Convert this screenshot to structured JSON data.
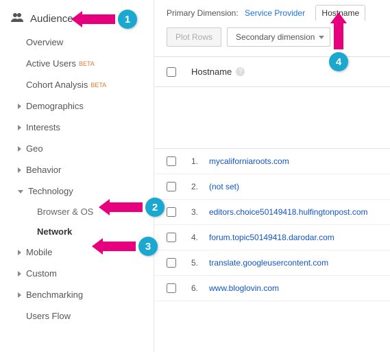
{
  "sidebar": {
    "section_label": "Audience",
    "items": [
      {
        "label": "Overview",
        "expandable": false
      },
      {
        "label": "Active Users",
        "expandable": false,
        "badge": "BETA"
      },
      {
        "label": "Cohort Analysis",
        "expandable": false,
        "badge": "BETA"
      },
      {
        "label": "Demographics",
        "expandable": true
      },
      {
        "label": "Interests",
        "expandable": true
      },
      {
        "label": "Geo",
        "expandable": true
      },
      {
        "label": "Behavior",
        "expandable": true
      },
      {
        "label": "Technology",
        "expandable": true,
        "expanded": true,
        "children": [
          {
            "label": "Browser & OS"
          },
          {
            "label": "Network",
            "selected": true
          }
        ]
      },
      {
        "label": "Mobile",
        "expandable": true
      },
      {
        "label": "Custom",
        "expandable": true
      },
      {
        "label": "Benchmarking",
        "expandable": true
      },
      {
        "label": "Users Flow",
        "expandable": false
      }
    ]
  },
  "primary_dimension": {
    "label": "Primary Dimension:",
    "link_service_provider": "Service Provider",
    "tab_hostname": "Hostname"
  },
  "controls": {
    "plot_rows": "Plot Rows",
    "secondary_dimension": "Secondary dimension"
  },
  "table": {
    "header_col": "Hostname",
    "rows": [
      {
        "idx": "1.",
        "host": "mycaliforniaroots.com"
      },
      {
        "idx": "2.",
        "host": "(not set)"
      },
      {
        "idx": "3.",
        "host": "editors.choice50149418.hulfingtonpost.com"
      },
      {
        "idx": "4.",
        "host": "forum.topic50149418.darodar.com"
      },
      {
        "idx": "5.",
        "host": "translate.googleusercontent.com"
      },
      {
        "idx": "6.",
        "host": "www.bloglovin.com"
      }
    ]
  },
  "annotations": {
    "a1": "1",
    "a2": "2",
    "a3": "3",
    "a4": "4"
  }
}
